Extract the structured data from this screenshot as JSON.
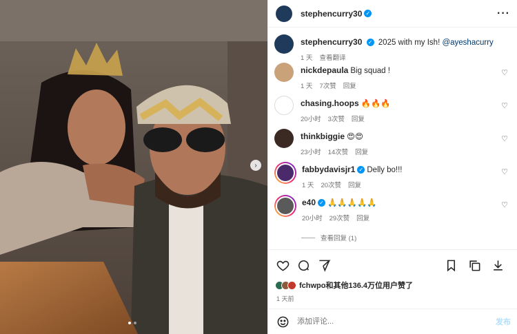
{
  "post": {
    "author": "stephencurry30",
    "more_icon": "more-horizontal-icon",
    "photo_next_icon": "chevron-right-icon",
    "photo_dots": 2,
    "photo_active_dot": 1
  },
  "caption": {
    "author": "stephencurry30",
    "text": "2025 with my Ish!",
    "mention": "@ayeshacurry",
    "time": "1 天",
    "translate": "查看翻译"
  },
  "comments": [
    {
      "user": "nickdepaula",
      "text": "Big squad !",
      "time": "1 天",
      "likes": "7次赞",
      "reply": "回复",
      "verified": false,
      "ring": false,
      "color": "#c9a27a"
    },
    {
      "user": "chasing.hoops",
      "text": "🔥🔥🔥",
      "time": "20小时",
      "likes": "3次赞",
      "reply": "回复",
      "verified": false,
      "ring": false,
      "color": "#ffffff"
    },
    {
      "user": "thinkbiggie",
      "text": "😍😍",
      "time": "23小时",
      "likes": "14次赞",
      "reply": "回复",
      "verified": false,
      "ring": false,
      "color": "#3b2a24"
    },
    {
      "user": "fabbydavisjr1",
      "text": "Delly bo!!!",
      "time": "1 天",
      "likes": "20次赞",
      "reply": "回复",
      "verified": true,
      "ring": true,
      "color": "#4a2a6a"
    },
    {
      "user": "e40",
      "text": "🙏🙏🙏🙏🙏",
      "time": "20小时",
      "likes": "29次赞",
      "reply": "回复",
      "verified": true,
      "ring": true,
      "color": "#5a5a5a"
    }
  ],
  "view_replies": "查看回复 (1)",
  "actions": {
    "like_icon": "heart-icon",
    "comment_icon": "comment-icon",
    "share_icon": "send-icon",
    "save_icon": "bookmark-icon",
    "repost_icon": "copy-icon",
    "download_icon": "download-icon"
  },
  "likes": {
    "text": "fchwpo和其他136.4万位用户赞了"
  },
  "posted_ago": "1 天前",
  "composer": {
    "emoji_icon": "smile-icon",
    "placeholder": "添加评论...",
    "post_label": "发布"
  }
}
